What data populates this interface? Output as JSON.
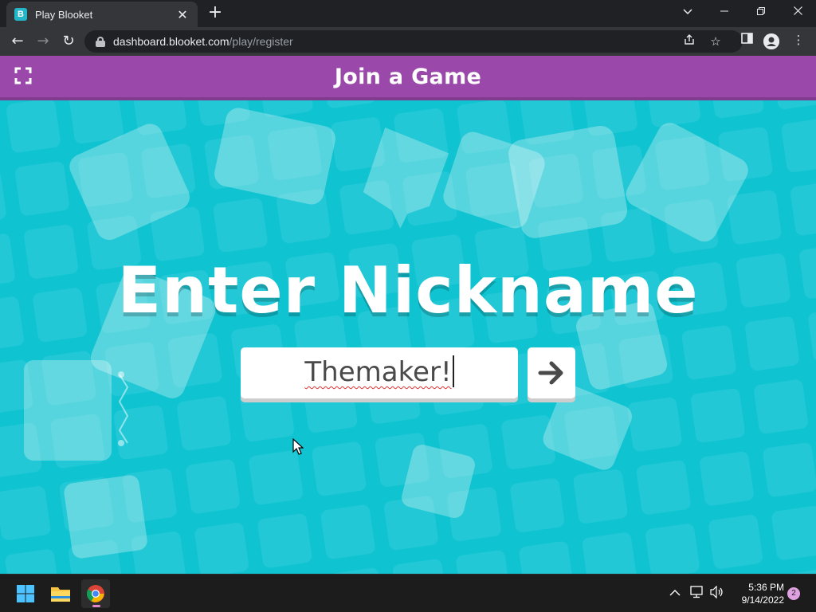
{
  "browser": {
    "tab_title": "Play Blooket",
    "tab_favicon_letter": "B",
    "url_host": "dashboard.blooket.com",
    "url_path": "/play/register"
  },
  "page": {
    "header_title": "Join a Game",
    "heading": "Enter Nickname",
    "nickname_value": "Themaker!",
    "colors": {
      "header_bg": "#9a49aa",
      "background": "#0fc3d1"
    }
  },
  "taskbar": {
    "time": "5:36 PM",
    "date": "9/14/2022",
    "notification_count": "2"
  }
}
